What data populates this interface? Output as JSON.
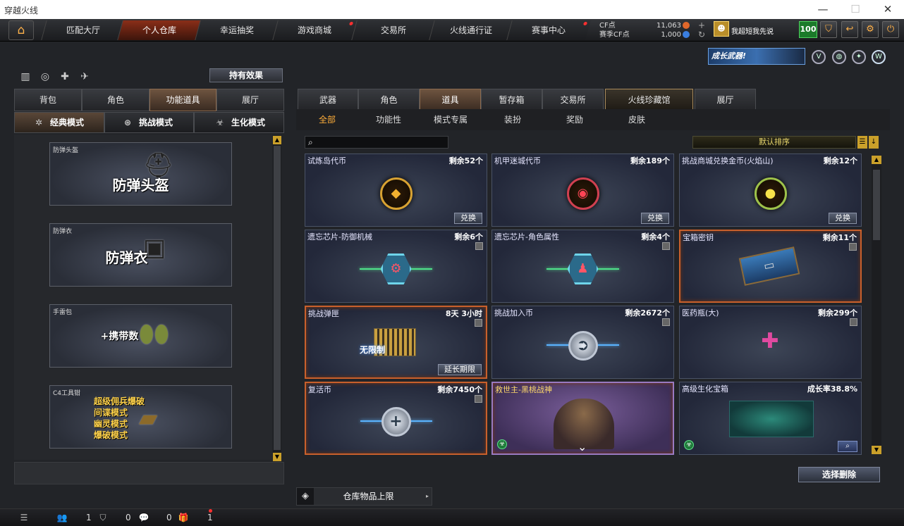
{
  "window": {
    "title": "穿越火线",
    "minimize": "—",
    "maximize": "☐",
    "close": "✕"
  },
  "topnav": {
    "home_icon": "home-icon",
    "tabs": [
      {
        "label": "匹配大厅",
        "dot": false
      },
      {
        "label": "个人仓库",
        "dot": false,
        "active": true
      },
      {
        "label": "幸运抽奖",
        "dot": false
      },
      {
        "label": "游戏商城",
        "dot": true
      },
      {
        "label": "交易所",
        "dot": false
      },
      {
        "label": "火线通行证",
        "dot": false
      },
      {
        "label": "赛事中心",
        "dot": true
      }
    ]
  },
  "currency": {
    "cf_label": "CF点",
    "cf_value": "11,063",
    "season_label": "赛季CF点",
    "season_value": "1,000",
    "add": "+",
    "refresh": "↻"
  },
  "user": {
    "avatar_glyph": "☻",
    "name": "我超短我先说",
    "level": "100"
  },
  "toolbar": {
    "shield": "⛉",
    "back": "↩",
    "settings": "⚙",
    "power": "⏻"
  },
  "banner": {
    "text": "成长武器!"
  },
  "left": {
    "effect_button": "持有效果",
    "quick_icons": [
      "▥",
      "◎",
      "✚",
      "✈"
    ],
    "tabs": [
      {
        "label": "背包"
      },
      {
        "label": "角色"
      },
      {
        "label": "功能道具",
        "active": true
      },
      {
        "label": "展厅"
      }
    ],
    "modes": [
      {
        "label": "经典模式",
        "icon": "✲",
        "active": true
      },
      {
        "label": "挑战模式",
        "icon": "⊛"
      },
      {
        "label": "生化模式",
        "icon": "☣"
      }
    ],
    "slots": [
      {
        "label": "防弹头盔",
        "title": "防弹头盔"
      },
      {
        "label": "防弹衣",
        "title": "防弹衣"
      },
      {
        "label": "手雷包",
        "title": "+携带数"
      },
      {
        "label": "C4工具钳",
        "lines": [
          "超级佣兵爆破",
          "间谍模式",
          "幽灵模式",
          "爆破模式"
        ]
      }
    ],
    "scroll_up": "▲",
    "scroll_down": "▼"
  },
  "right": {
    "tabs": [
      {
        "label": "武器"
      },
      {
        "label": "角色"
      },
      {
        "label": "道具",
        "active": true
      },
      {
        "label": "暂存箱"
      },
      {
        "label": "交易所"
      },
      {
        "label": "火线珍藏馆",
        "special": true
      },
      {
        "label": "展厅"
      }
    ],
    "subtabs": [
      {
        "label": "全部",
        "active": true
      },
      {
        "label": "功能性"
      },
      {
        "label": "模式专属"
      },
      {
        "label": "装扮"
      },
      {
        "label": "奖励"
      },
      {
        "label": "皮肤"
      }
    ],
    "search_icon": "⌕",
    "sort": "默认排序",
    "sort_list_icon": "☰",
    "sort_dir_icon": "↓",
    "items": [
      {
        "name": "试炼岛代币",
        "count": "剩余52个",
        "btn": "兑换",
        "glyph": "◆"
      },
      {
        "name": "机甲迷城代币",
        "count": "剩余189个",
        "btn": "兑换",
        "glyph": "◉"
      },
      {
        "name": "挑战商城兑换金币(火焰山)",
        "count": "剩余12个",
        "btn": "兑换",
        "glyph": "●"
      },
      {
        "name": "遗忘芯片-防御机械",
        "count": "剩余6个",
        "lock": "🔒",
        "glyph": "⚙"
      },
      {
        "name": "遗忘芯片-角色属性",
        "count": "剩余4个",
        "lock": "🔒",
        "glyph": "♟"
      },
      {
        "name": "宝箱密钥",
        "count": "剩余11个",
        "lock": "🔒",
        "glyph": "▭"
      },
      {
        "name": "挑战弹匣",
        "count": "8天 3小时",
        "lock": "🔒",
        "btn": "延长期限",
        "art": "无限制"
      },
      {
        "name": "挑战加入币",
        "count": "剩余2672个",
        "lock": "🔒",
        "glyph": "➲"
      },
      {
        "name": "医药瓶(大)",
        "count": "剩余299个",
        "lock": "🔒",
        "glyph": "✚"
      },
      {
        "name": "复活币",
        "count": "剩余7450个",
        "lock": "🔒",
        "glyph": "+"
      },
      {
        "name": "救世主-黑桃战神",
        "count": "",
        "bio": "☣",
        "down": "⌄"
      },
      {
        "name": "高级生化宝箱",
        "count": "成长率38.8%",
        "bio": "☣",
        "btn_icon": "⌕"
      }
    ],
    "scroll_up": "▲",
    "scroll_down": "▼",
    "delete_button": "选择删除"
  },
  "capacity": {
    "icon": "◈",
    "label": "仓库物品上限",
    "arrow": "▸"
  },
  "statusbar": {
    "list_icon": "☰",
    "friends_count": "1",
    "shield_count": "0",
    "chat_count": "0",
    "gift_count": "1"
  },
  "colors": {
    "accent": "#ffae3a",
    "highlight_border": "#c9602c",
    "active_tab": "#8a2e18"
  }
}
